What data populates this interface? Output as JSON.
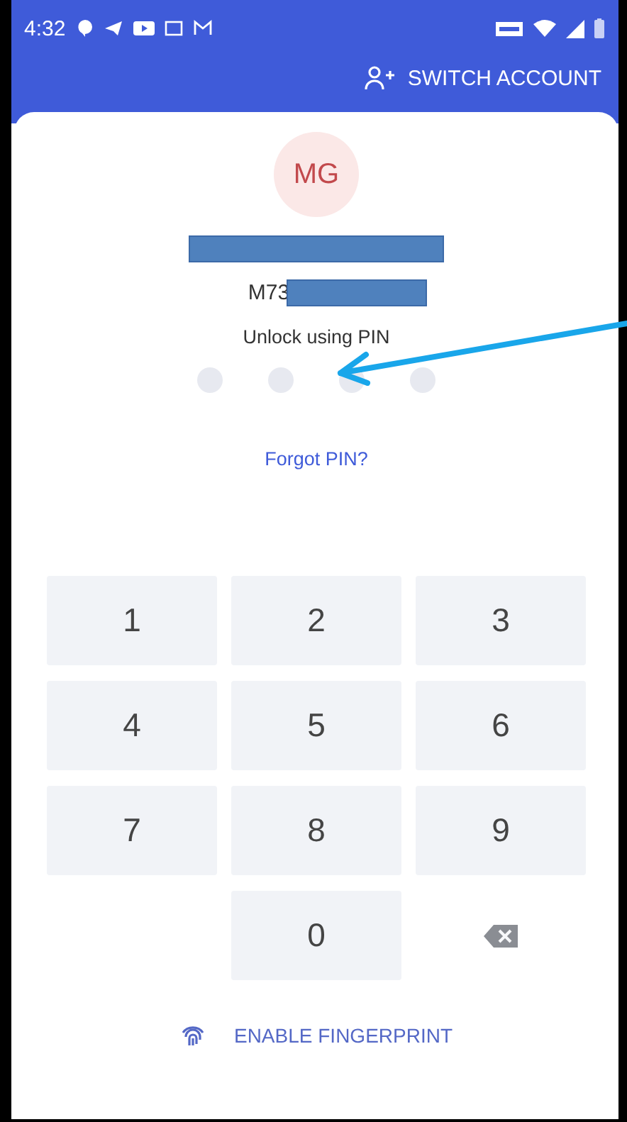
{
  "status_bar": {
    "time": "4:32"
  },
  "header": {
    "switch_account": "SWITCH ACCOUNT"
  },
  "account": {
    "initials": "MG",
    "id": "M73"
  },
  "prompt": "Unlock using PIN",
  "pin_dots": [
    {
      "filled": false
    },
    {
      "filled": false
    },
    {
      "filled": false
    },
    {
      "filled": false
    }
  ],
  "forgot_link": "Forgot PIN?",
  "keys": [
    {
      "kind": "digit",
      "label": "1"
    },
    {
      "kind": "digit",
      "label": "2"
    },
    {
      "kind": "digit",
      "label": "3"
    },
    {
      "kind": "digit",
      "label": "4"
    },
    {
      "kind": "digit",
      "label": "5"
    },
    {
      "kind": "digit",
      "label": "6"
    },
    {
      "kind": "digit",
      "label": "7"
    },
    {
      "kind": "digit",
      "label": "8"
    },
    {
      "kind": "digit",
      "label": "9"
    },
    {
      "kind": "empty"
    },
    {
      "kind": "digit",
      "label": "0"
    },
    {
      "kind": "backspace"
    }
  ],
  "fingerprint_button": "ENABLE FINGERPRINT"
}
